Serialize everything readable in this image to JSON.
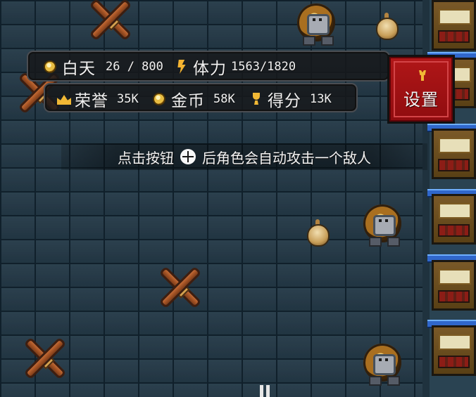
{
  "hud": {
    "day": {
      "label": "白天",
      "value": "26 / 800"
    },
    "stamina": {
      "label": "体力",
      "value": "1563/1820"
    },
    "honor": {
      "label": "荣誉",
      "value": "35K"
    },
    "gold": {
      "label": "金币",
      "value": "58K"
    },
    "score": {
      "label": "得分",
      "value": "13K"
    }
  },
  "settings_button": {
    "label": "设置"
  },
  "hint": {
    "before": "点击按钮",
    "after": "后角色会自动攻击一个敌人"
  },
  "icons": {
    "day": "sun-coin-icon",
    "stamina": "lightning-icon",
    "honor": "crown-icon",
    "gold": "gold-coin-icon",
    "score": "trophy-icon",
    "settings": "wrench-icon",
    "attack": "crosshair-icon"
  },
  "colors": {
    "hud_bg": "#17181a",
    "settings_red": "#a71317",
    "icon_gold": "#f1b835",
    "text_light": "#f1f1f1"
  }
}
